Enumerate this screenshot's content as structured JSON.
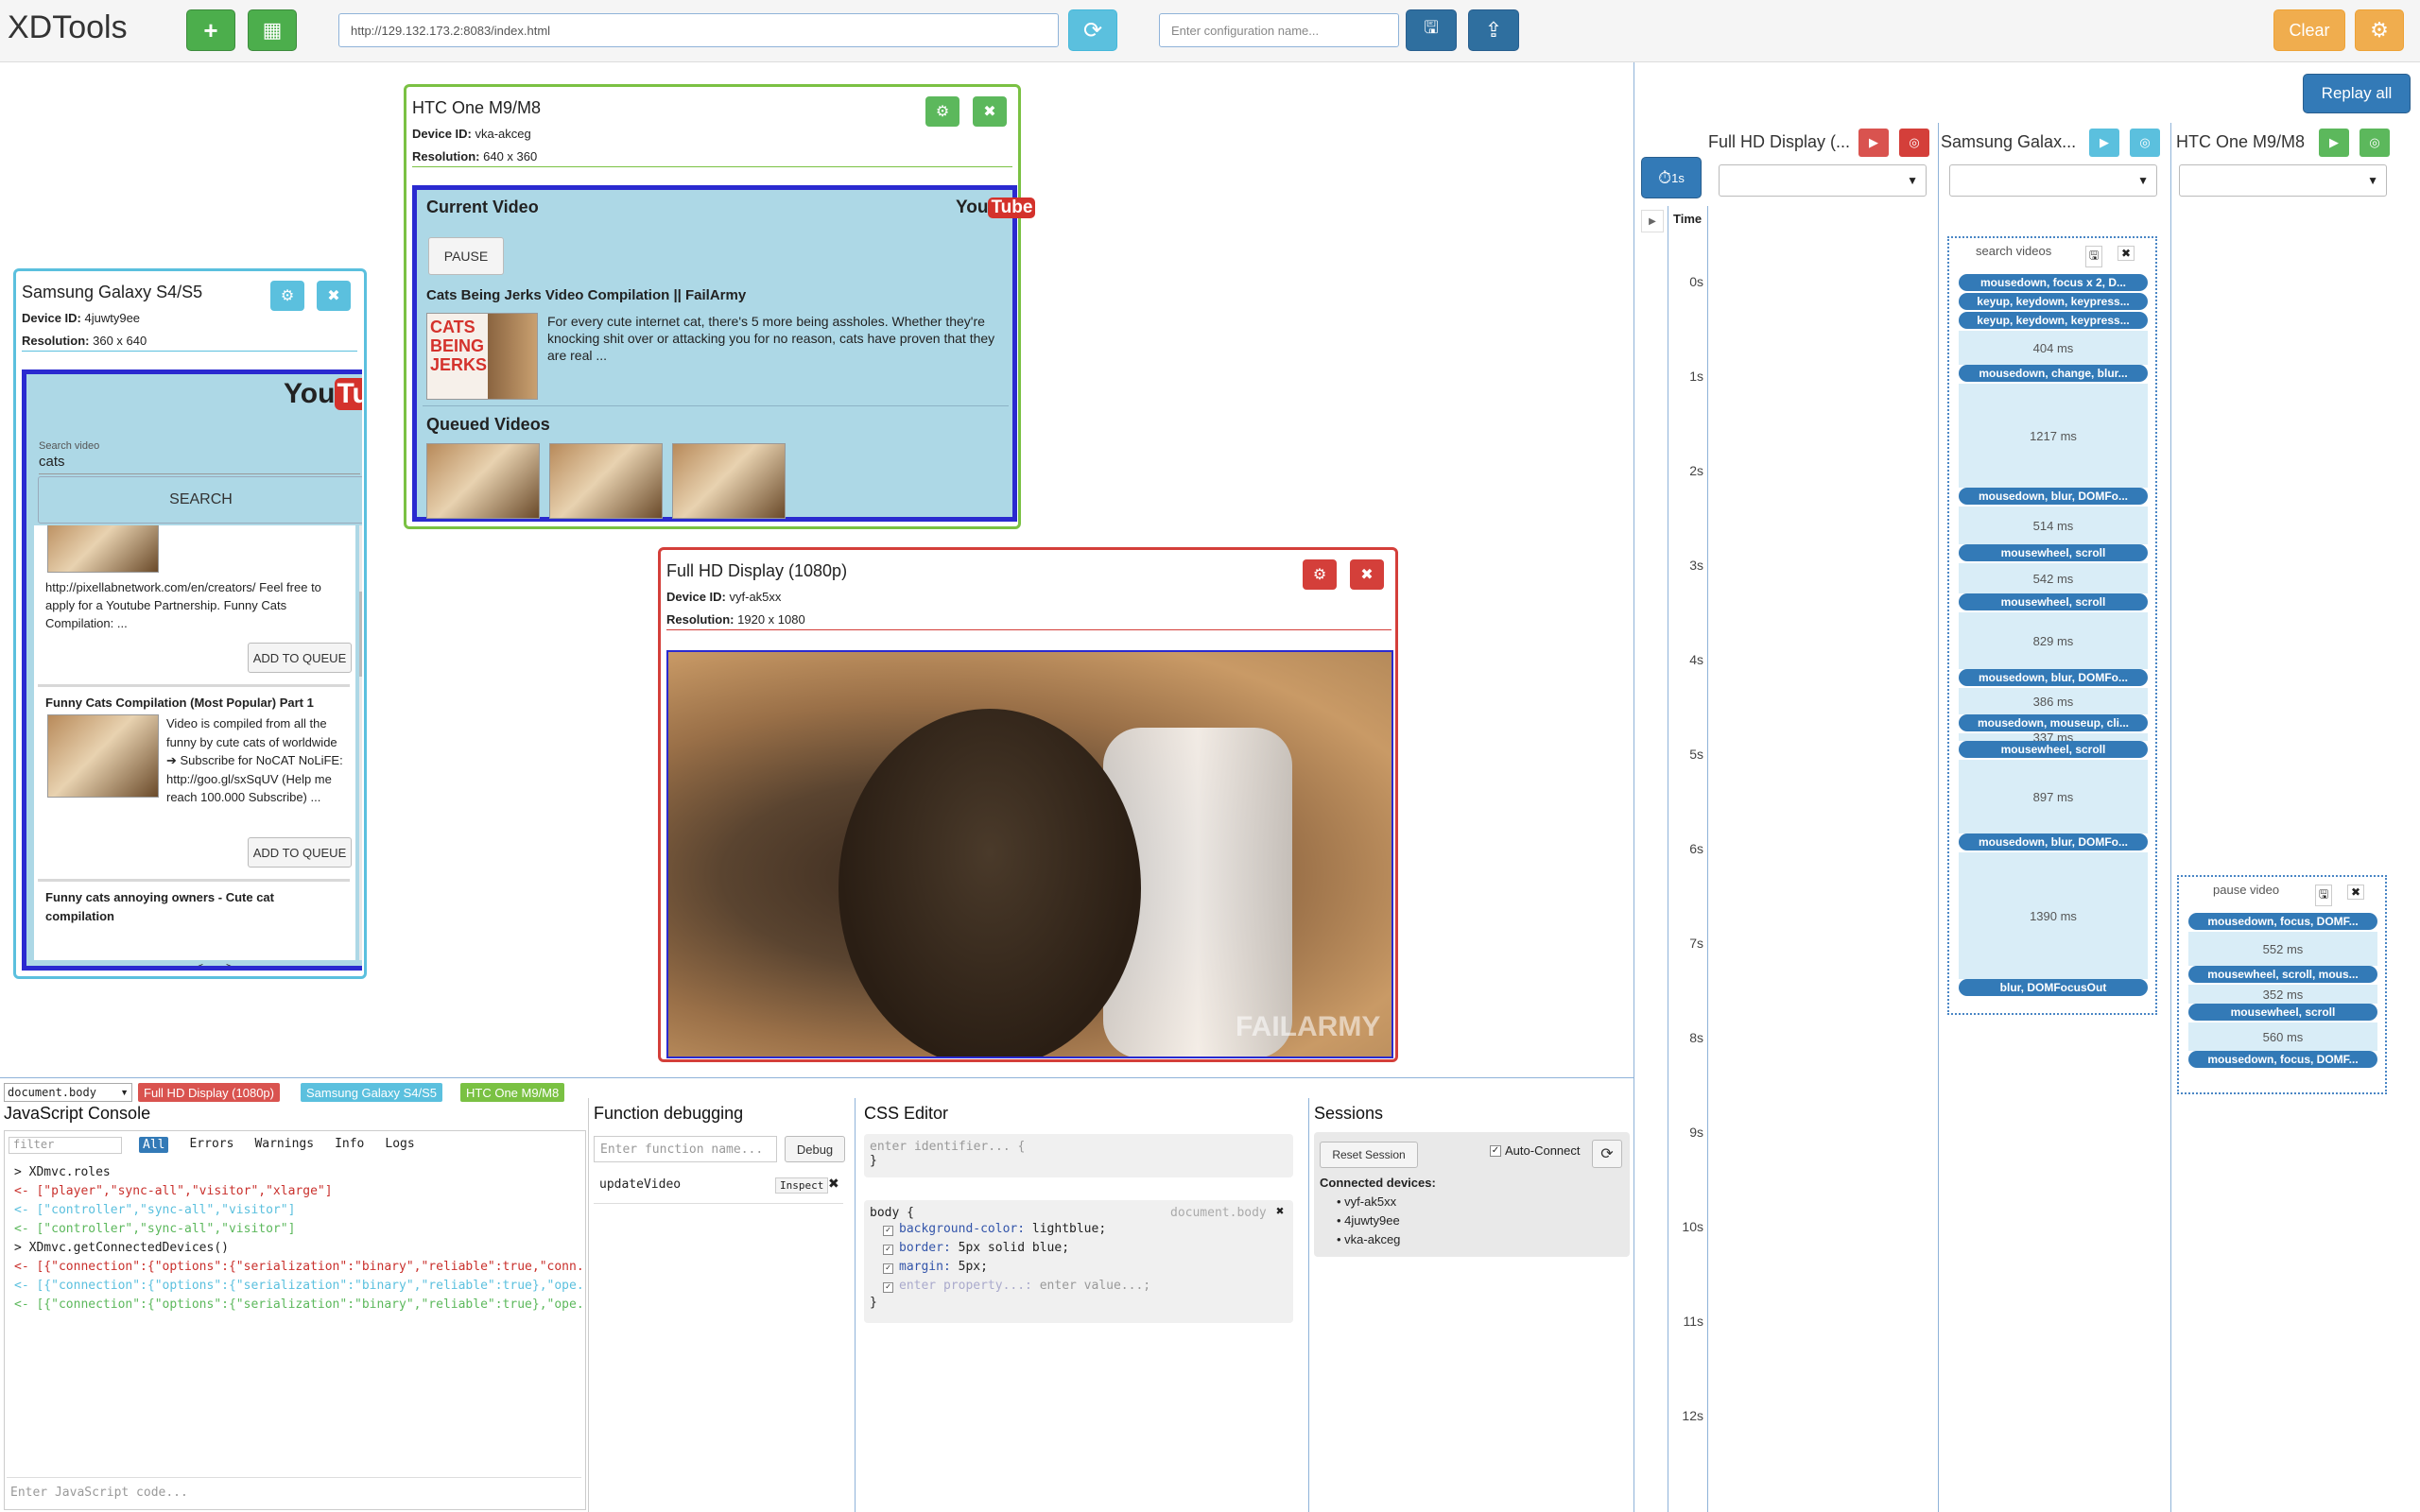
{
  "app": {
    "title": "XDTools"
  },
  "toolbar": {
    "url": "http://129.132.173.2:8083/index.html",
    "config_placeholder": "Enter configuration name...",
    "clear_label": "Clear"
  },
  "devices": {
    "htc": {
      "title": "HTC One M9/M8",
      "id_label": "Device ID:",
      "id": "vka-akceg",
      "res_label": "Resolution:",
      "res": "640 x 360",
      "current_video_label": "Current Video",
      "pause_label": "PAUSE",
      "video_title": "Cats Being Jerks Video Compilation || FailArmy",
      "video_desc": "For every cute internet cat, there's 5 more being assholes. Whether they're knocking shit over or attacking you for no reason, cats have proven that they are real ...",
      "thumb_text": "CATS BEING JERKS",
      "queued_label": "Queued Videos"
    },
    "samsung": {
      "title": "Samsung Galaxy S4/S5",
      "id_label": "Device ID:",
      "id": "4juwty9ee",
      "res_label": "Resolution:",
      "res": "360 x 640",
      "search_label": "Search video",
      "search_value": "cats",
      "search_button": "SEARCH",
      "item1_desc": "http://pixellabnetwork.com/en/creators/ Feel free to apply for a Youtube Partnership. Funny Cats Compilation: ...",
      "add_queue": "ADD TO QUEUE",
      "item2_title": "Funny Cats Compilation (Most Popular) Part 1",
      "item2_desc": "Video is compiled from all the funny by cute cats of worldwide ➔ Subscribe for NoCAT NoLiFE: http://goo.gl/sxSqUV (Help me reach 100.000 Subscribe) ...",
      "item3_title": "Funny cats annoying owners - Cute cat compilation",
      "prev": "<",
      "next": ">"
    },
    "fullhd": {
      "title": "Full HD Display (1080p)",
      "id_label": "Device ID:",
      "id": "vyf-ak5xx",
      "res_label": "Resolution:",
      "res": "1920 x 1080",
      "watermark": "FAILARMY"
    }
  },
  "youtube": {
    "you": "You",
    "tube": "Tube"
  },
  "bottom": {
    "selector": "document.body",
    "tag_fullhd": "Full HD Display (1080p)",
    "tag_samsung": "Samsung Galaxy S4/S5",
    "tag_htc": "HTC One M9/M8",
    "console": {
      "title": "JavaScript Console",
      "filter_placeholder": "filter",
      "levels": [
        "All",
        "Errors",
        "Warnings",
        "Info",
        "Logs"
      ],
      "lines": [
        {
          "text": "> XDmvc.roles",
          "color": "#222"
        },
        {
          "text": "<- [\"player\",\"sync-all\",\"visitor\",\"xlarge\"]",
          "color": "#c9302c"
        },
        {
          "text": "<- [\"controller\",\"sync-all\",\"visitor\"]",
          "color": "#5bc0de"
        },
        {
          "text": "<- [\"controller\",\"sync-all\",\"visitor\"]",
          "color": "#5cb85c"
        },
        {
          "text": "> XDmvc.getConnectedDevices()",
          "color": "#222"
        },
        {
          "text": "<- [{\"connection\":{\"options\":{\"serialization\":\"binary\",\"reliable\":true,\"conn...",
          "color": "#c9302c"
        },
        {
          "text": "<- [{\"connection\":{\"options\":{\"serialization\":\"binary\",\"reliable\":true},\"ope...",
          "color": "#5bc0de"
        },
        {
          "text": "<- [{\"connection\":{\"options\":{\"serialization\":\"binary\",\"reliable\":true},\"ope...",
          "color": "#5cb85c"
        }
      ],
      "input_placeholder": "Enter JavaScript code..."
    },
    "debug": {
      "title": "Function debugging",
      "placeholder": "Enter function name...",
      "debug_button": "Debug",
      "fn": "updateVideo",
      "inspect": "Inspect"
    },
    "css": {
      "title": "CSS Editor",
      "ident_placeholder": "enter identifier... {",
      "close_brace": "}",
      "selector": "body {",
      "source": "document.body",
      "rules": [
        {
          "prop": "background-color:",
          "val": "lightblue;"
        },
        {
          "prop": "border:",
          "val": "5px solid blue;"
        },
        {
          "prop": "margin:",
          "val": "5px;"
        },
        {
          "prop": "enter property...:",
          "val": "enter value...;"
        }
      ]
    },
    "sessions": {
      "title": "Sessions",
      "reset": "Reset Session",
      "auto_connect": "Auto-Connect",
      "connected_label": "Connected devices:",
      "devices": [
        "vyf-ak5xx",
        "4juwty9ee",
        "vka-akceg"
      ]
    }
  },
  "timeline": {
    "replay_all": "Replay all",
    "interval": "1s",
    "time_label": "Time",
    "ticks": [
      "0s",
      "1s",
      "2s",
      "3s",
      "4s",
      "5s",
      "6s",
      "7s",
      "8s",
      "9s",
      "10s",
      "11s",
      "12s"
    ],
    "columns": [
      "Full HD Display (...",
      "Samsung Galax...",
      "HTC One M9/M8"
    ],
    "search_session": {
      "title": "search videos",
      "items": [
        {
          "kind": "ev",
          "text": "mousedown, focus x 2, D..."
        },
        {
          "kind": "ev",
          "text": "keyup, keydown, keypress..."
        },
        {
          "kind": "ev",
          "text": "keyup, keydown, keypress..."
        },
        {
          "kind": "gap",
          "text": "404 ms"
        },
        {
          "kind": "ev",
          "text": "mousedown, change, blur..."
        },
        {
          "kind": "gap",
          "text": "1217 ms"
        },
        {
          "kind": "ev",
          "text": "mousedown, blur, DOMFo..."
        },
        {
          "kind": "gap",
          "text": "514 ms"
        },
        {
          "kind": "ev",
          "text": "mousewheel, scroll"
        },
        {
          "kind": "gap",
          "text": "542 ms"
        },
        {
          "kind": "ev",
          "text": "mousewheel, scroll"
        },
        {
          "kind": "gap",
          "text": "829 ms"
        },
        {
          "kind": "ev",
          "text": "mousedown, blur, DOMFo..."
        },
        {
          "kind": "gap",
          "text": "386 ms"
        },
        {
          "kind": "ev",
          "text": "mousedown, mouseup, cli..."
        },
        {
          "kind": "gap",
          "text": "337 ms"
        },
        {
          "kind": "ev",
          "text": "mousewheel, scroll"
        },
        {
          "kind": "gap",
          "text": "897 ms"
        },
        {
          "kind": "ev",
          "text": "mousedown, blur, DOMFo..."
        },
        {
          "kind": "gap",
          "text": "1390 ms"
        },
        {
          "kind": "ev",
          "text": "blur, DOMFocusOut"
        }
      ]
    },
    "pause_session": {
      "title": "pause video",
      "items": [
        {
          "kind": "ev",
          "text": "mousedown, focus, DOMF..."
        },
        {
          "kind": "gap",
          "text": "552 ms"
        },
        {
          "kind": "ev",
          "text": "mousewheel, scroll, mous..."
        },
        {
          "kind": "gap",
          "text": "352 ms"
        },
        {
          "kind": "ev",
          "text": "mousewheel, scroll"
        },
        {
          "kind": "gap",
          "text": "560 ms"
        },
        {
          "kind": "ev",
          "text": "mousedown, focus, DOMF..."
        }
      ]
    }
  },
  "colors": {
    "htc": "#7ac143",
    "samsung": "#5bc0de",
    "fullhd": "#d43f3a",
    "accent": "#337ab7"
  }
}
